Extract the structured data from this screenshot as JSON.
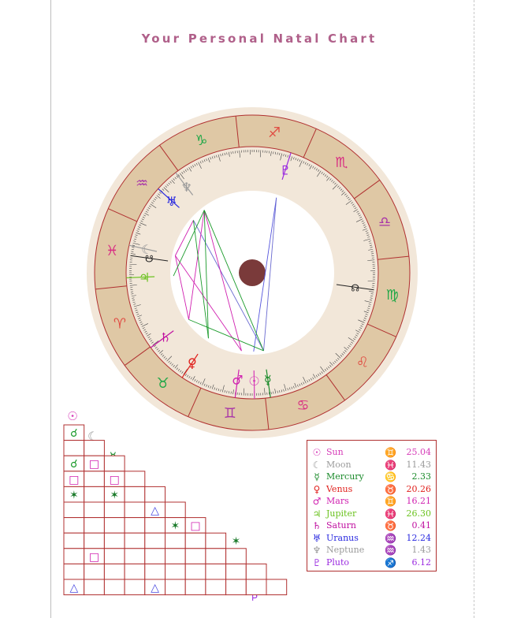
{
  "page": {
    "title": "Your Personal Natal Chart"
  },
  "colors": {
    "title": "#b0608a",
    "frame": "#b03030",
    "zodiac_band": "#dfc8a5",
    "wheel_halo": "#f2e7d9",
    "inner_band": "#f2e7d9",
    "center_dot": "#7a3a3a",
    "fire": "#e04e44",
    "earth": "#22a848",
    "air": "#a833a8",
    "water": "#d82c82"
  },
  "chart_data": {
    "type": "natal_wheel",
    "zodiac": [
      {
        "sign": "Aries",
        "glyph": "♈",
        "element": "fire"
      },
      {
        "sign": "Taurus",
        "glyph": "♉",
        "element": "earth"
      },
      {
        "sign": "Gemini",
        "glyph": "♊",
        "element": "air"
      },
      {
        "sign": "Cancer",
        "glyph": "♋",
        "element": "water"
      },
      {
        "sign": "Leo",
        "glyph": "♌",
        "element": "fire"
      },
      {
        "sign": "Virgo",
        "glyph": "♍",
        "element": "earth"
      },
      {
        "sign": "Libra",
        "glyph": "♎",
        "element": "air"
      },
      {
        "sign": "Scorpio",
        "glyph": "♏",
        "element": "water"
      },
      {
        "sign": "Sagittarius",
        "glyph": "♐",
        "element": "fire"
      },
      {
        "sign": "Capricorn",
        "glyph": "♑",
        "element": "earth"
      },
      {
        "sign": "Aquarius",
        "glyph": "♒",
        "element": "air"
      },
      {
        "sign": "Pisces",
        "glyph": "♓",
        "element": "water"
      }
    ],
    "ascendant_longitude": 354,
    "nodes": [
      {
        "name": "North Node",
        "glyph": "☊",
        "longitude": 166,
        "color": "#222222"
      },
      {
        "name": "South Node",
        "glyph": "☋",
        "longitude": 346,
        "color": "#222222"
      }
    ],
    "planets": [
      {
        "name": "Sun",
        "glyph": "☉",
        "sign_glyph": "♊",
        "degree": "25.04",
        "longitude": 85.04,
        "color": "#d63cb8"
      },
      {
        "name": "Moon",
        "glyph": "☾",
        "sign_glyph": "♓",
        "degree": "11.43",
        "longitude": 341.43,
        "color": "#9a9a9a"
      },
      {
        "name": "Mercury",
        "glyph": "☿",
        "sign_glyph": "♋",
        "degree": "2.33",
        "longitude": 92.33,
        "color": "#1a8a2a"
      },
      {
        "name": "Venus",
        "glyph": "♀",
        "sign_glyph": "♉",
        "degree": "20.26",
        "longitude": 50.26,
        "color": "#e0201c"
      },
      {
        "name": "Mars",
        "glyph": "♂",
        "sign_glyph": "♊",
        "degree": "16.21",
        "longitude": 76.21,
        "color": "#d020b0"
      },
      {
        "name": "Jupiter",
        "glyph": "♃",
        "sign_glyph": "♓",
        "degree": "26.30",
        "longitude": 356.3,
        "color": "#6ac21e"
      },
      {
        "name": "Saturn",
        "glyph": "♄",
        "sign_glyph": "♉",
        "degree": "0.41",
        "longitude": 30.41,
        "color": "#c010a0"
      },
      {
        "name": "Uranus",
        "glyph": "♅",
        "sign_glyph": "♒",
        "degree": "12.24",
        "longitude": 312.24,
        "color": "#2a2ae0"
      },
      {
        "name": "Neptune",
        "glyph": "♆",
        "sign_glyph": "♒",
        "degree": "1.43",
        "longitude": 301.43,
        "color": "#9a9a9a"
      },
      {
        "name": "Pluto",
        "glyph": "♇",
        "sign_glyph": "♐",
        "degree": "6.12",
        "longitude": 246.12,
        "color": "#9a2ae0"
      }
    ],
    "aspect_lines": [
      {
        "from": "Sun",
        "to": "Pluto",
        "color": "#5555dd"
      },
      {
        "from": "Mercury",
        "to": "Pluto",
        "color": "#6a6ad0"
      },
      {
        "from": "Mercury",
        "to": "Uranus",
        "color": "#6a6ad0"
      },
      {
        "from": "Moon",
        "to": "Mars",
        "color": "#d020b0"
      },
      {
        "from": "Moon",
        "to": "Saturn",
        "color": "#d020b0"
      },
      {
        "from": "Moon",
        "to": "Uranus",
        "color": "#d020b0"
      },
      {
        "from": "Mars",
        "to": "Neptune",
        "color": "#d020b0"
      },
      {
        "from": "Saturn",
        "to": "Neptune",
        "color": "#d020b0"
      },
      {
        "from": "Mercury",
        "to": "Saturn",
        "color": "#1a9a2a"
      },
      {
        "from": "Mercury",
        "to": "Neptune",
        "color": "#1a9a2a"
      },
      {
        "from": "Venus",
        "to": "Neptune",
        "color": "#1a9a2a"
      },
      {
        "from": "Jupiter",
        "to": "Neptune",
        "color": "#1a9a2a"
      },
      {
        "from": "Venus",
        "to": "Uranus",
        "color": "#1a9a2a"
      }
    ],
    "aspect_grid": {
      "symbols": {
        "conjunction": {
          "glyph": "☌",
          "color": "#1a9a2a"
        },
        "square": {
          "glyph": "□",
          "color": "#d020b0"
        },
        "sextile": {
          "glyph": "✶",
          "color": "#1a7a2a"
        },
        "trine": {
          "glyph": "△",
          "color": "#4a4ae0"
        }
      },
      "cells": [
        {
          "row": 2,
          "col": 0,
          "type": "conjunction"
        },
        {
          "row": 4,
          "col": 0,
          "type": "conjunction"
        },
        {
          "row": 4,
          "col": 1,
          "type": "square"
        },
        {
          "row": 5,
          "col": 0,
          "type": "square"
        },
        {
          "row": 5,
          "col": 2,
          "type": "square"
        },
        {
          "row": 6,
          "col": 0,
          "type": "sextile"
        },
        {
          "row": 6,
          "col": 2,
          "type": "sextile"
        },
        {
          "row": 7,
          "col": 4,
          "type": "trine"
        },
        {
          "row": 8,
          "col": 5,
          "type": "sextile"
        },
        {
          "row": 8,
          "col": 6,
          "type": "square"
        },
        {
          "row": 9,
          "col": 8,
          "type": "sextile"
        },
        {
          "row": 10,
          "col": 1,
          "type": "square"
        },
        {
          "row": 12,
          "col": 0,
          "type": "trine"
        },
        {
          "row": 12,
          "col": 4,
          "type": "trine"
        }
      ]
    }
  }
}
